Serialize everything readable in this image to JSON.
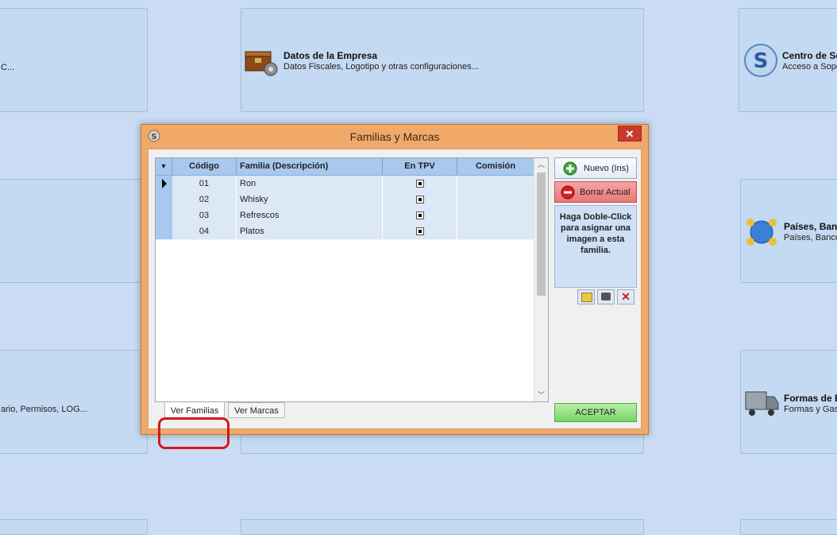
{
  "background_tiles": {
    "empresa": {
      "title": "Datos de la Empresa",
      "subtitle": "Datos Fiscales, Logotipo y otras configuraciones..."
    },
    "soporte": {
      "title": "Centro de So",
      "subtitle": "Acceso a Sopo"
    },
    "paises": {
      "title": "Países, Banco",
      "subtitle": "Países, Banco"
    },
    "formas": {
      "title": "Formas de E",
      "subtitle": "Formas y Gas"
    },
    "left_top_sub": "C...",
    "left_bottom_sub": "ario, Permisos, LOG..."
  },
  "dialog": {
    "title": "Familias y Marcas",
    "close": "✕"
  },
  "grid": {
    "columns": [
      "Código",
      "Familia (Descripción)",
      "En TPV",
      "Comisión"
    ],
    "rows": [
      {
        "codigo": "01",
        "familia": "Ron",
        "tpv": true,
        "comision": ""
      },
      {
        "codigo": "02",
        "familia": "Whisky",
        "tpv": true,
        "comision": ""
      },
      {
        "codigo": "03",
        "familia": "Refrescos",
        "tpv": true,
        "comision": ""
      },
      {
        "codigo": "04",
        "familia": "Platos",
        "tpv": true,
        "comision": ""
      }
    ]
  },
  "tabs": {
    "familias": "Ver Familias",
    "marcas": "Ver Marcas"
  },
  "actions": {
    "nuevo": "Nuevo (Ins)",
    "borrar": "Borrar Actual",
    "image_hint": "Haga Doble-Click para asignar una imagen a esta familia.",
    "aceptar": "ACEPTAR"
  },
  "colors": {
    "dialog_frame": "#f0a968",
    "header": "#a8c8ee",
    "row": "#dde8f6",
    "highlight": "#d6161e"
  }
}
